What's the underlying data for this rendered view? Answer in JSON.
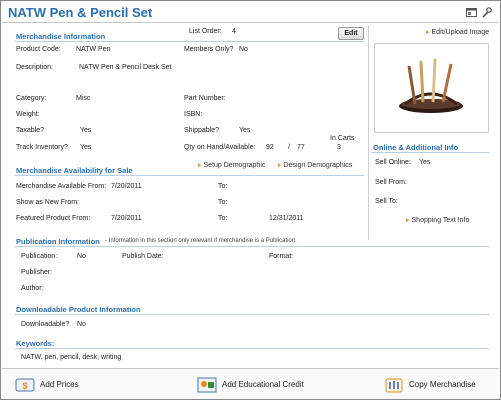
{
  "window": {
    "title": "NATW Pen & Pencil Set"
  },
  "header": {
    "list_order_label": "List Order:",
    "list_order_value": "4",
    "edit_label": "Edit",
    "edit_upload_label": "Edit/Upload Image"
  },
  "merch_info": {
    "heading": "Merchandise Information",
    "product_code_label": "Product Code:",
    "product_code_value": "NATW Pen",
    "members_only_label": "Members Only?",
    "members_only_value": "No",
    "description_label": "Description:",
    "description_value": "NATW Pen & Pencil Desk Set",
    "category_label": "Category:",
    "category_value": "Misc",
    "part_number_label": "Part Number:",
    "part_number_value": "",
    "weight_label": "Weight:",
    "weight_value": "",
    "isbn_label": "ISBN:",
    "isbn_value": "",
    "taxable_label": "Taxable?",
    "taxable_value": "Yes",
    "shippable_label": "Shippable?",
    "shippable_value": "Yes",
    "track_inventory_label": "Track Inventory?",
    "track_inventory_value": "Yes",
    "qty_label": "Qty on Hand/Available:",
    "qty_on_hand": "92",
    "qty_sep": "/",
    "qty_available": "77",
    "in_carts_label": "In Carts",
    "in_carts_value": "3"
  },
  "availability": {
    "heading": "Merchandise Availability for Sale",
    "setup_demographic": "Setup Demographic",
    "design_demographics": "Design Demographics",
    "available_from_label": "Merchandise Available From:",
    "available_from_value": "7/20/2011",
    "to_label": "To:",
    "available_to_value": "",
    "show_new_label": "Show as New From:",
    "show_new_value": "",
    "show_new_to_value": "",
    "featured_label": "Featured Product From:",
    "featured_from_value": "7/20/2011",
    "featured_to_value": "12/31/2011"
  },
  "online": {
    "heading": "Online & Additional Info",
    "sell_online_label": "Sell Online:",
    "sell_online_value": "Yes",
    "sell_from_label": "Sell From:",
    "sell_to_label": "Sell To:",
    "shopping_text_label": "Shopping Text Info"
  },
  "publication": {
    "heading": "Publication Information",
    "note": "- Information in this section only relevant if merchandise is a Publication.",
    "publication_label": "Publication:",
    "publication_value": "No",
    "publish_date_label": "Publish Date:",
    "format_label": "Format:",
    "publisher_label": "Publisher:",
    "author_label": "Author:"
  },
  "downloadable": {
    "heading": "Downloadable Product Information",
    "downloadable_label": "Downloadable?",
    "downloadable_value": "No"
  },
  "keywords": {
    "heading": "Keywords:",
    "value": "NATW, pen, pencil, desk, writing"
  },
  "bottom": {
    "add_prices": "Add Prices",
    "add_credit": "Add Educational Credit",
    "copy_merch": "Copy Merchandise"
  },
  "colors": {
    "accent": "#2a6fb0",
    "link_arrow": "#e08a1e"
  }
}
